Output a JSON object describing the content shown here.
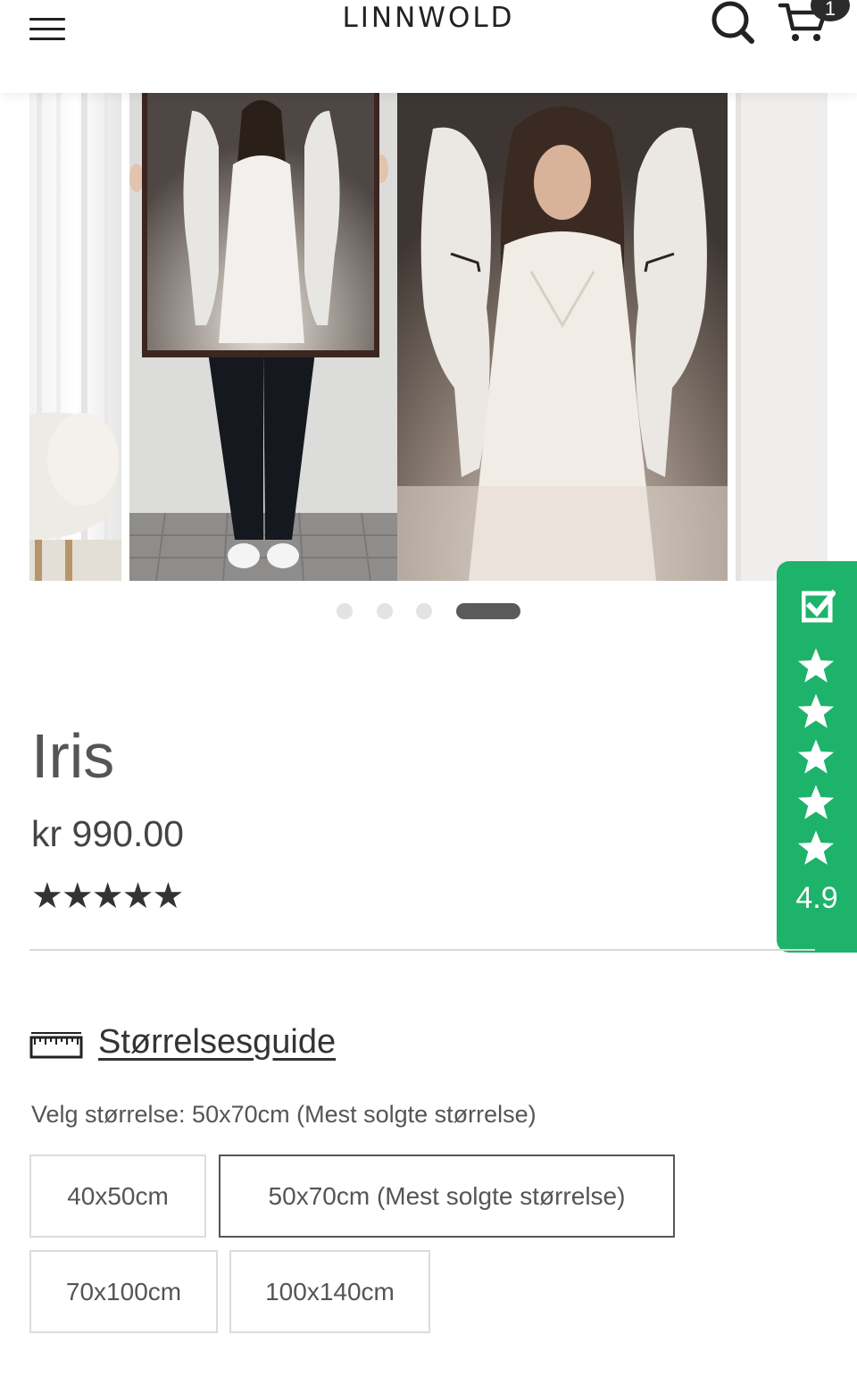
{
  "header": {
    "logo": "LINNWOLD",
    "cart_count": "1"
  },
  "gallery": {
    "dot_count": 4,
    "active_dot": 3
  },
  "reviews": {
    "score": "4.9",
    "stars": 5
  },
  "product": {
    "title": "Iris",
    "price": "kr 990.00",
    "rating_stars": "★★★★★"
  },
  "size_guide": {
    "label": "Størrelsesguide"
  },
  "size_selector": {
    "label": "Velg størrelse: 50x70cm (Mest solgte størrelse)",
    "options": [
      "40x50cm",
      "50x70cm (Mest solgte størrelse)",
      "70x100cm",
      "100x140cm"
    ],
    "selected": "50x70cm (Mest solgte størrelse)"
  },
  "colors": {
    "review_green": "#1db36a",
    "text_dark": "#444444"
  }
}
